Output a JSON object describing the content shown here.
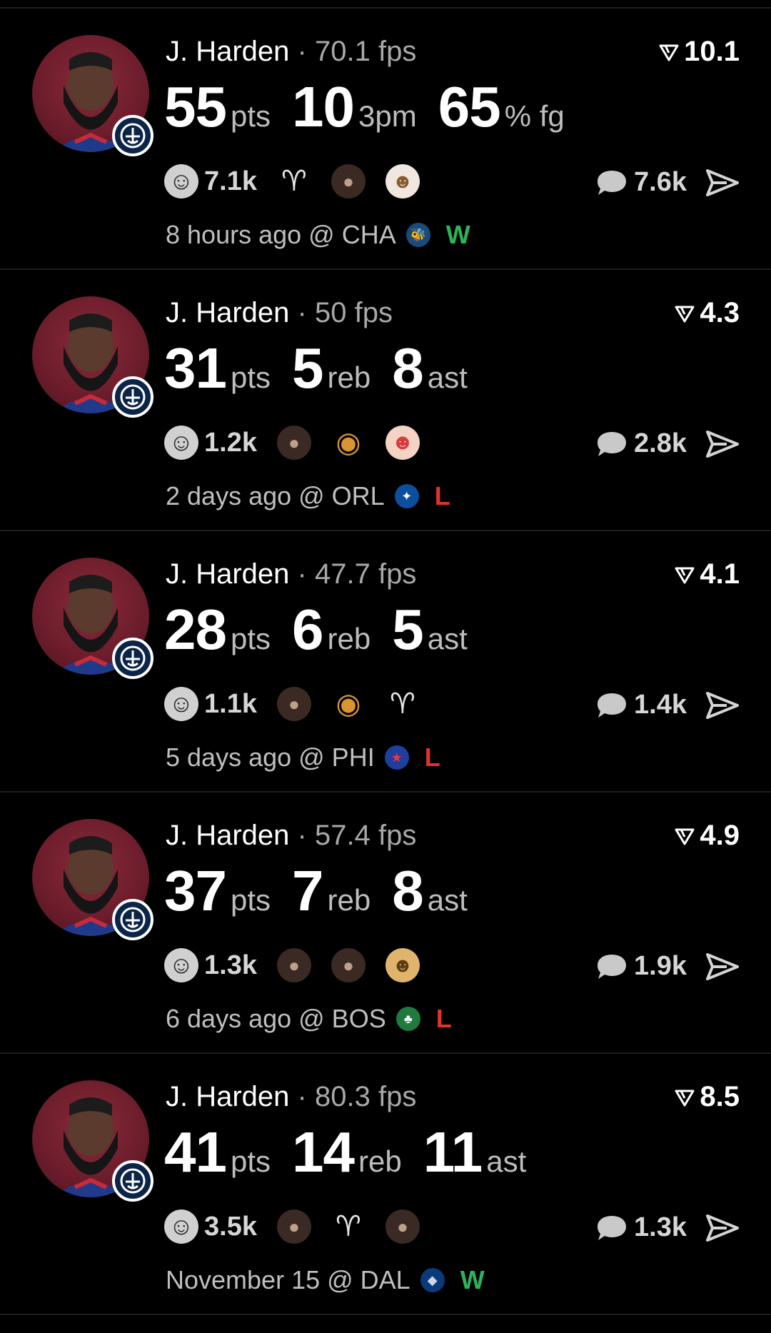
{
  "posts": [
    {
      "player": "J. Harden",
      "separator": "·",
      "fps": "70.1 fps",
      "rating": "10.1",
      "stats": [
        {
          "value": "55",
          "unit": "pts"
        },
        {
          "value": "10",
          "unit": "3pm"
        },
        {
          "value": "65",
          "unit": "% fg"
        }
      ],
      "reaction_count": "7.1k",
      "reactions": [
        "goat",
        "harden-face",
        "chef"
      ],
      "comment_count": "7.6k",
      "time": "8 hours ago @ CHA",
      "team_logo": "hornets-logo",
      "result": "W"
    },
    {
      "player": "J. Harden",
      "separator": "·",
      "fps": "50 fps",
      "rating": "4.3",
      "stats": [
        {
          "value": "31",
          "unit": "pts"
        },
        {
          "value": "5",
          "unit": "reb"
        },
        {
          "value": "8",
          "unit": "ast"
        }
      ],
      "reaction_count": "1.2k",
      "reactions": [
        "harden-face",
        "burger",
        "clown"
      ],
      "comment_count": "2.8k",
      "time": "2 days ago @ ORL",
      "team_logo": "magic-logo",
      "result": "L"
    },
    {
      "player": "J. Harden",
      "separator": "·",
      "fps": "47.7 fps",
      "rating": "4.1",
      "stats": [
        {
          "value": "28",
          "unit": "pts"
        },
        {
          "value": "6",
          "unit": "reb"
        },
        {
          "value": "5",
          "unit": "ast"
        }
      ],
      "reaction_count": "1.1k",
      "reactions": [
        "harden-face",
        "burger",
        "goat"
      ],
      "comment_count": "1.4k",
      "time": "5 days ago @ PHI",
      "team_logo": "76ers-logo",
      "result": "L"
    },
    {
      "player": "J. Harden",
      "separator": "·",
      "fps": "57.4 fps",
      "rating": "4.9",
      "stats": [
        {
          "value": "37",
          "unit": "pts"
        },
        {
          "value": "7",
          "unit": "reb"
        },
        {
          "value": "8",
          "unit": "ast"
        }
      ],
      "reaction_count": "1.3k",
      "reactions": [
        "harden-face",
        "harden-face",
        "older-person"
      ],
      "comment_count": "1.9k",
      "time": "6 days ago @ BOS",
      "team_logo": "celtics-logo",
      "result": "L"
    },
    {
      "player": "J. Harden",
      "separator": "·",
      "fps": "80.3 fps",
      "rating": "8.5",
      "stats": [
        {
          "value": "41",
          "unit": "pts"
        },
        {
          "value": "14",
          "unit": "reb"
        },
        {
          "value": "11",
          "unit": "ast"
        }
      ],
      "reaction_count": "3.5k",
      "reactions": [
        "harden-face",
        "goat",
        "harden-face"
      ],
      "comment_count": "1.3k",
      "time": "November 15 @ DAL",
      "team_logo": "mavericks-logo",
      "result": "W"
    }
  ],
  "colors": {
    "background": "#000000",
    "win": "#2eb35a",
    "loss": "#e0332d",
    "avatar_bg": "#6b1c2b",
    "badge": "#0b2447"
  }
}
